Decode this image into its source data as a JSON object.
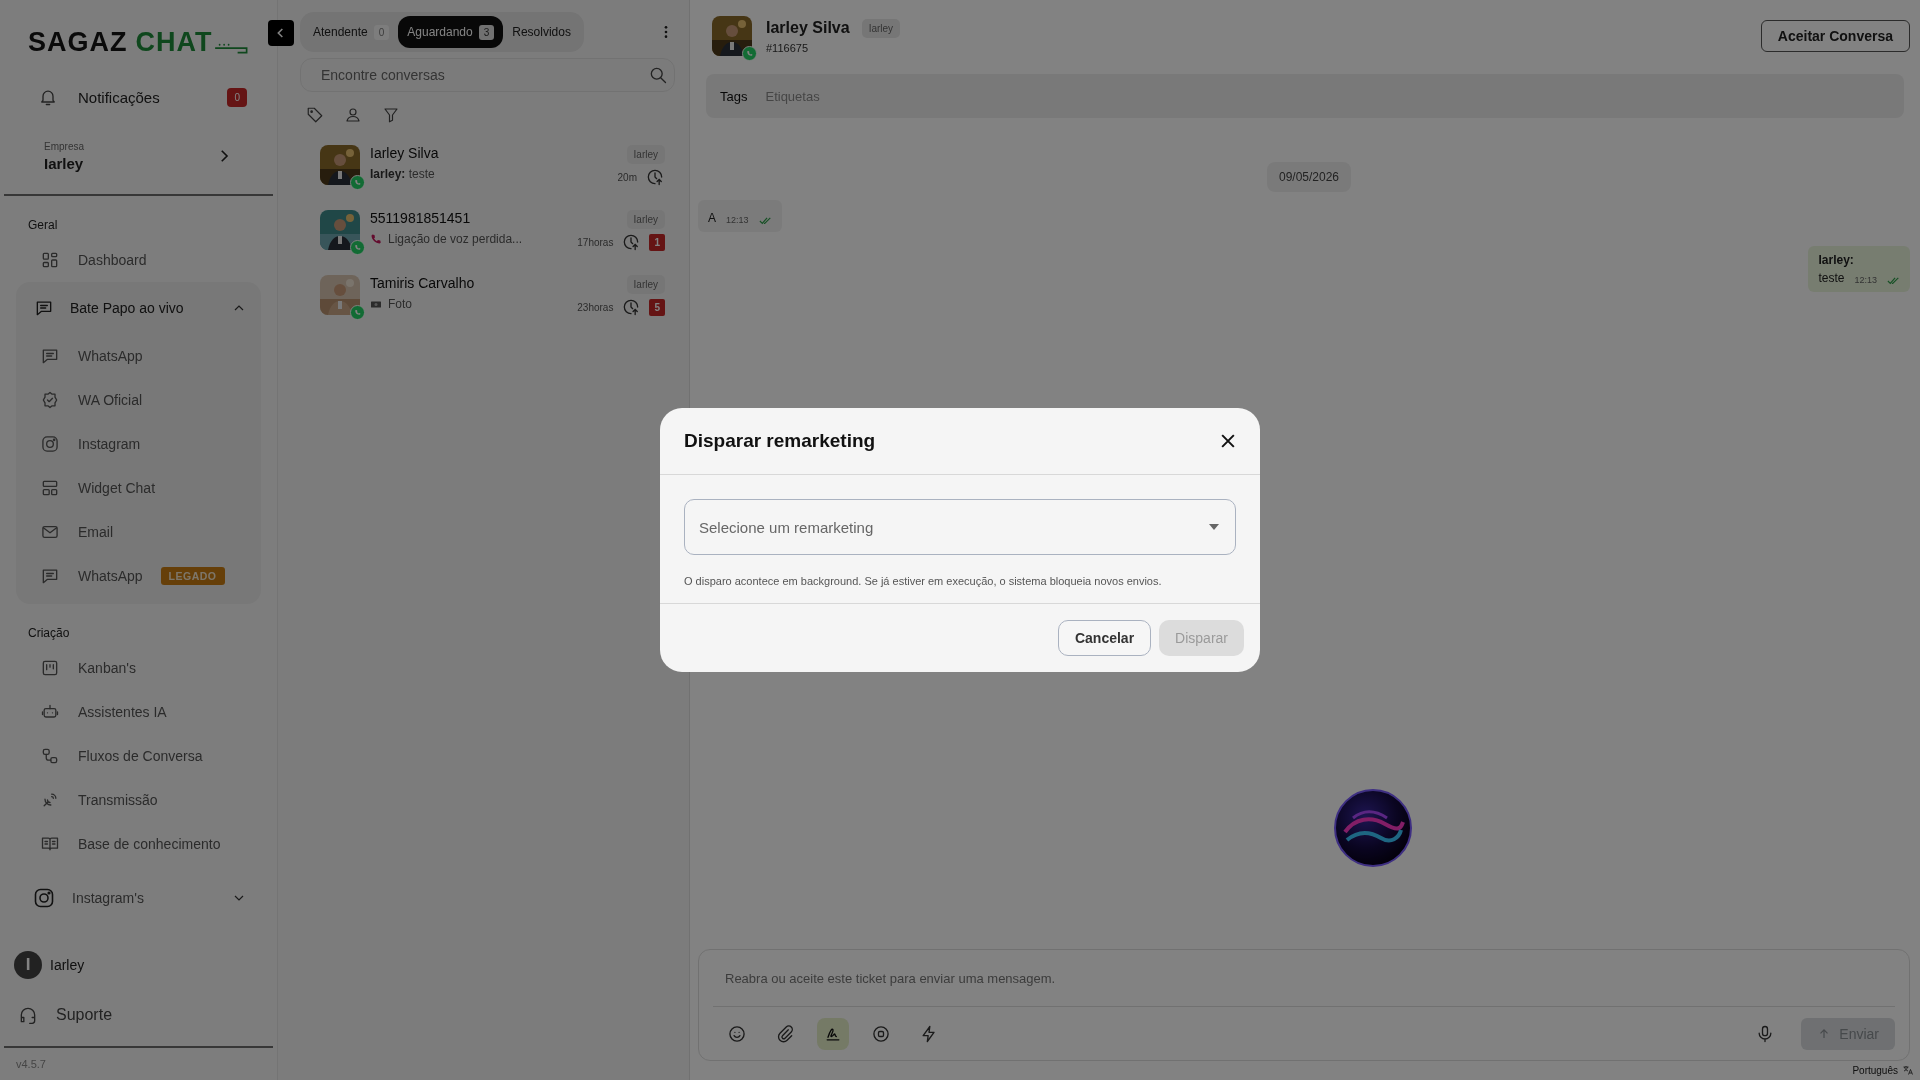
{
  "brand": {
    "word": "SAGAZ",
    "accent": "CHAT"
  },
  "sidebar": {
    "notifications": {
      "label": "Notificações",
      "count": "0"
    },
    "company": {
      "caption": "Empresa",
      "name": "Iarley"
    },
    "groups": [
      {
        "title": "Geral",
        "items": [
          {
            "label": "Dashboard"
          },
          {
            "label": "Bate Papo ao vivo",
            "expanded": true,
            "children": [
              {
                "label": "WhatsApp"
              },
              {
                "label": "WA Oficial"
              },
              {
                "label": "Instagram"
              },
              {
                "label": "Widget Chat"
              },
              {
                "label": "Email"
              },
              {
                "label": "WhatsApp",
                "badge": "LEGADO"
              }
            ]
          }
        ]
      },
      {
        "title": "Criação",
        "items": [
          {
            "label": "Kanban's"
          },
          {
            "label": "Assistentes IA"
          },
          {
            "label": "Fluxos de Conversa"
          },
          {
            "label": "Transmissão"
          },
          {
            "label": "Base de conhecimento"
          },
          {
            "label": "Instagram's",
            "expanded": false
          }
        ]
      }
    ],
    "user": {
      "initial": "I",
      "name": "Iarley"
    },
    "support": "Suporte",
    "version": "v4.5.7"
  },
  "conversations": {
    "tabs": [
      {
        "label": "Atendente",
        "count": "0",
        "selected": false
      },
      {
        "label": "Aguardando",
        "count": "3",
        "selected": true
      },
      {
        "label": "Resolvidos",
        "selected": false
      }
    ],
    "search": {
      "placeholder": "Encontre conversas"
    },
    "items": [
      {
        "name": "Iarley Silva",
        "kind": "text",
        "preview": "**Iarley:** teste",
        "agent": "Iarley",
        "time": "20m"
      },
      {
        "name": "5511981851451",
        "kind": "call",
        "preview": "Ligação de voz perdida...",
        "agent": "Iarley",
        "time": "17horas",
        "unread": "1"
      },
      {
        "name": "Tamiris Carvalho",
        "preview": "Foto",
        "agent": "Iarley",
        "time": "23horas",
        "unread": "5"
      }
    ]
  },
  "chat": {
    "name": "Iarley Silva",
    "agent": "Iarley",
    "ticket": "#116675",
    "accept": "Aceitar Conversa",
    "tags": {
      "label": "Tags",
      "placeholder": "Etiquetas"
    },
    "date": "09/05/2026",
    "messages": [
      {
        "kind": "incoming",
        "text": "A",
        "time": "12:13"
      },
      {
        "kind": "outgoing",
        "author": "Iarley:",
        "text": "teste",
        "time": "12:13"
      }
    ],
    "composer": {
      "placeholder": "Reabra ou aceite este ticket para enviar uma mensagem.",
      "tools": [
        {
          "active": false
        },
        {
          "active": false
        },
        {
          "active": true
        },
        {
          "active": false
        },
        {
          "active": false
        }
      ],
      "send": {
        "label": "Enviar",
        "disabled": true
      }
    },
    "language": "Português"
  },
  "modal": {
    "title": "Disparar remarketing",
    "select": {
      "placeholder": "Selecione um remarketing"
    },
    "hint": "O disparo acontece em background. Se já estiver em execução, o sistema bloqueia novos envios.",
    "cancel": "Cancelar",
    "confirm": {
      "label": "Disparar",
      "disabled": true
    }
  }
}
